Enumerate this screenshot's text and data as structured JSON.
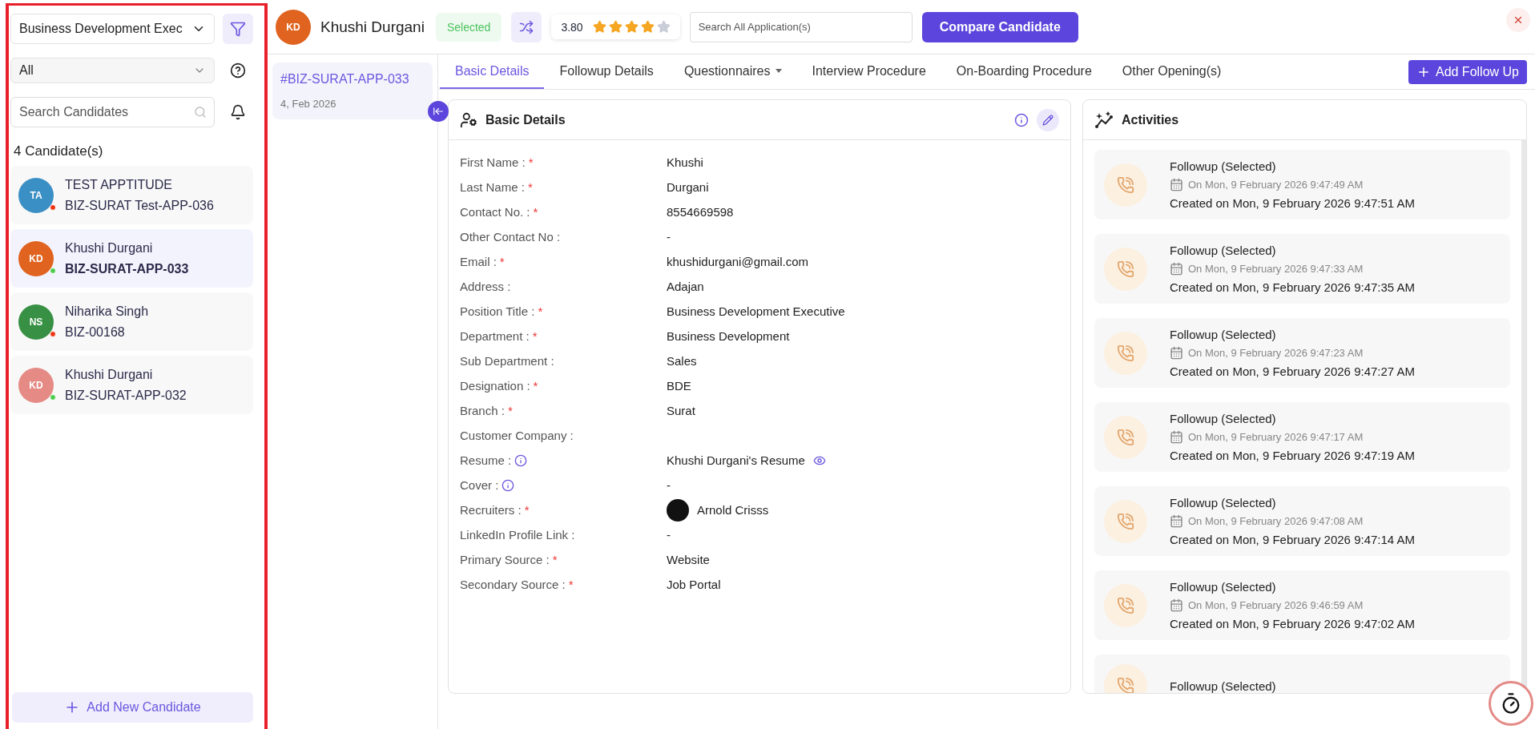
{
  "sidebar": {
    "position_filter": {
      "value": "Business Development Exec"
    },
    "status_filter": {
      "value": "All"
    },
    "search": {
      "placeholder": "Search Candidates"
    },
    "count": "4 Candidate(s)",
    "candidates": [
      {
        "initials": "TA",
        "name": "TEST APPTITUDE",
        "code": "BIZ-SURAT Test-APP-036",
        "color": "#3a8fc4",
        "online": false,
        "selected": false
      },
      {
        "initials": "KD",
        "name": "Khushi Durgani",
        "code": "BIZ-SURAT-APP-033",
        "color": "#e0631f",
        "online": true,
        "selected": true
      },
      {
        "initials": "NS",
        "name": "Niharika Singh",
        "code": "BIZ-00168",
        "color": "#379043",
        "online": false,
        "selected": false
      },
      {
        "initials": "KD",
        "name": "Khushi Durgani",
        "code": "BIZ-SURAT-APP-032",
        "color": "#e58a84",
        "online": true,
        "selected": false
      }
    ],
    "add_button": "Add New Candidate"
  },
  "header": {
    "avatar_initials": "KD",
    "name": "Khushi Durgani",
    "status": "Selected",
    "rating": "3.80",
    "stars": 4,
    "search": {
      "placeholder": "Search All Application(s)"
    },
    "compare_button": "Compare Candidate"
  },
  "application": {
    "code": "#BIZ-SURAT-APP-033",
    "date": "4, Feb 2026",
    "selected": true
  },
  "tabs": [
    {
      "label": "Basic Details",
      "selected": true,
      "dropdown": false
    },
    {
      "label": "Followup Details",
      "selected": false,
      "dropdown": false
    },
    {
      "label": "Questionnaires",
      "selected": false,
      "dropdown": true
    },
    {
      "label": "Interview Procedure",
      "selected": false,
      "dropdown": false
    },
    {
      "label": "On-Boarding Procedure",
      "selected": false,
      "dropdown": false
    },
    {
      "label": "Other Opening(s)",
      "selected": false,
      "dropdown": false
    }
  ],
  "add_follow_up": "Add Follow Up",
  "basic_details": {
    "title": "Basic Details",
    "fields": [
      {
        "label": "First Name :",
        "asterisk": "*",
        "info": false,
        "kind": "text",
        "value": "Khushi"
      },
      {
        "label": "Last Name :",
        "asterisk": "*",
        "info": false,
        "kind": "text",
        "value": "Durgani"
      },
      {
        "label": "Contact No. :",
        "asterisk": "*",
        "info": false,
        "kind": "text",
        "value": "8554669598"
      },
      {
        "label": "Other Contact No :",
        "info": false,
        "kind": "text",
        "value": "-"
      },
      {
        "label": "Email :",
        "asterisk": "*",
        "info": false,
        "kind": "text",
        "value": "khushidurgani@gmail.com"
      },
      {
        "label": "Address :",
        "info": false,
        "kind": "text",
        "value": "Adajan"
      },
      {
        "label": "Position Title :",
        "asterisk": "*",
        "info": false,
        "kind": "text",
        "value": "Business Development Executive"
      },
      {
        "label": "Department :",
        "asterisk": "*",
        "info": false,
        "kind": "text",
        "value": "Business Development"
      },
      {
        "label": "Sub Department :",
        "info": false,
        "kind": "text",
        "value": "Sales"
      },
      {
        "label": "Designation :",
        "asterisk": "*",
        "info": false,
        "kind": "text",
        "value": "BDE"
      },
      {
        "label": "Branch :",
        "asterisk": "*",
        "info": false,
        "kind": "text",
        "value": "Surat"
      },
      {
        "label": "Customer Company :",
        "info": false,
        "kind": "text"
      },
      {
        "label": "Resume :",
        "info": true,
        "kind": "file",
        "value": "Khushi Durgani's Resume"
      },
      {
        "label": "Cover :",
        "info": true,
        "kind": "text",
        "value": "-"
      },
      {
        "label": "Recruiters :",
        "asterisk": "*",
        "info": false,
        "kind": "person",
        "value": "Arnold Crisss"
      },
      {
        "label": "LinkedIn Profile Link :",
        "info": false,
        "kind": "text",
        "value": "-"
      },
      {
        "label": "Primary Source :",
        "asterisk": "*",
        "info": false,
        "kind": "text",
        "value": "Website"
      },
      {
        "label": "Secondary Source :",
        "asterisk": "*",
        "info": false,
        "kind": "text",
        "value": "Job Portal"
      }
    ]
  },
  "activities": {
    "title": "Activities",
    "items": [
      {
        "title": "Followup (Selected)",
        "date": "On Mon, 9 February 2026 9:47:49 AM",
        "created": "Created on Mon, 9 February 2026 9:47:51 AM"
      },
      {
        "title": "Followup (Selected)",
        "date": "On Mon, 9 February 2026 9:47:33 AM",
        "created": "Created on Mon, 9 February 2026 9:47:35 AM"
      },
      {
        "title": "Followup (Selected)",
        "date": "On Mon, 9 February 2026 9:47:23 AM",
        "created": "Created on Mon, 9 February 2026 9:47:27 AM"
      },
      {
        "title": "Followup (Selected)",
        "date": "On Mon, 9 February 2026 9:47:17 AM",
        "created": "Created on Mon, 9 February 2026 9:47:19 AM"
      },
      {
        "title": "Followup (Selected)",
        "date": "On Mon, 9 February 2026 9:47:08 AM",
        "created": "Created on Mon, 9 February 2026 9:47:14 AM"
      },
      {
        "title": "Followup (Selected)",
        "date": "On Mon, 9 February 2026 9:46:59 AM",
        "created": "Created on Mon, 9 February 2026 9:47:02 AM"
      },
      {
        "title": "Followup (Selected)"
      }
    ]
  }
}
